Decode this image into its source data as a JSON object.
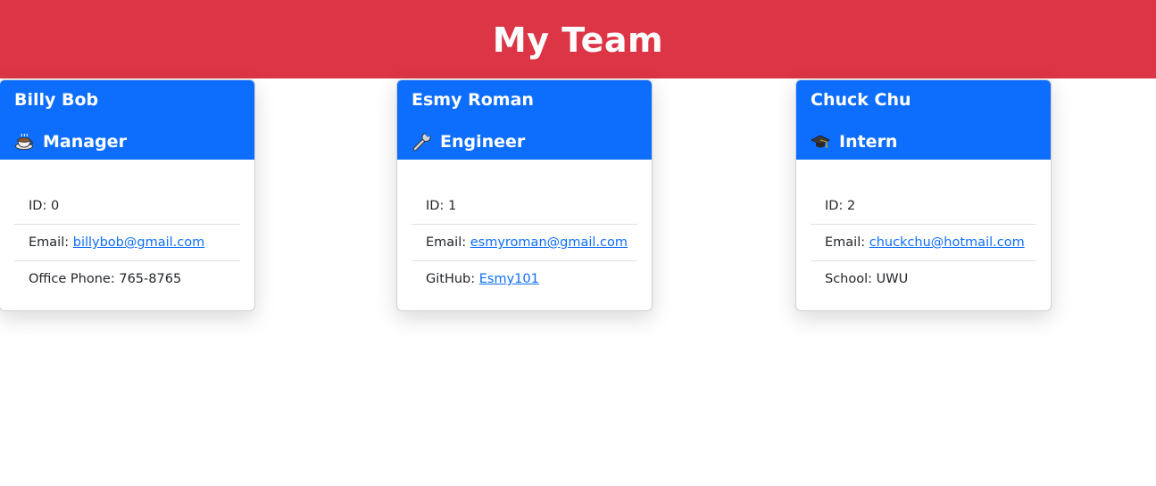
{
  "header": {
    "title": "My Team"
  },
  "colors": {
    "header_bg": "#dc3545",
    "card_header_bg": "#0d6efd",
    "link": "#0d6efd"
  },
  "team": [
    {
      "name": "Billy Bob",
      "role": "Manager",
      "role_icon": "coffee-cup-icon",
      "id_label": "ID: ",
      "id_value": "0",
      "email_label": "Email: ",
      "email": "billybob@gmail.com",
      "extra_label": "Office Phone: ",
      "extra_value": "765-8765"
    },
    {
      "name": "Esmy Roman",
      "role": "Engineer",
      "role_icon": "wrench-icon",
      "id_label": "ID: ",
      "id_value": "1",
      "email_label": "Email: ",
      "email": "esmyroman@gmail.com",
      "extra_label": "GitHub: ",
      "extra_value": "Esmy101"
    },
    {
      "name": "Chuck Chu",
      "role": "Intern",
      "role_icon": "graduation-cap-icon",
      "id_label": "ID: ",
      "id_value": "2",
      "email_label": "Email: ",
      "email": "chuckchu@hotmail.com",
      "extra_label": "School: ",
      "extra_value": "UWU"
    }
  ]
}
